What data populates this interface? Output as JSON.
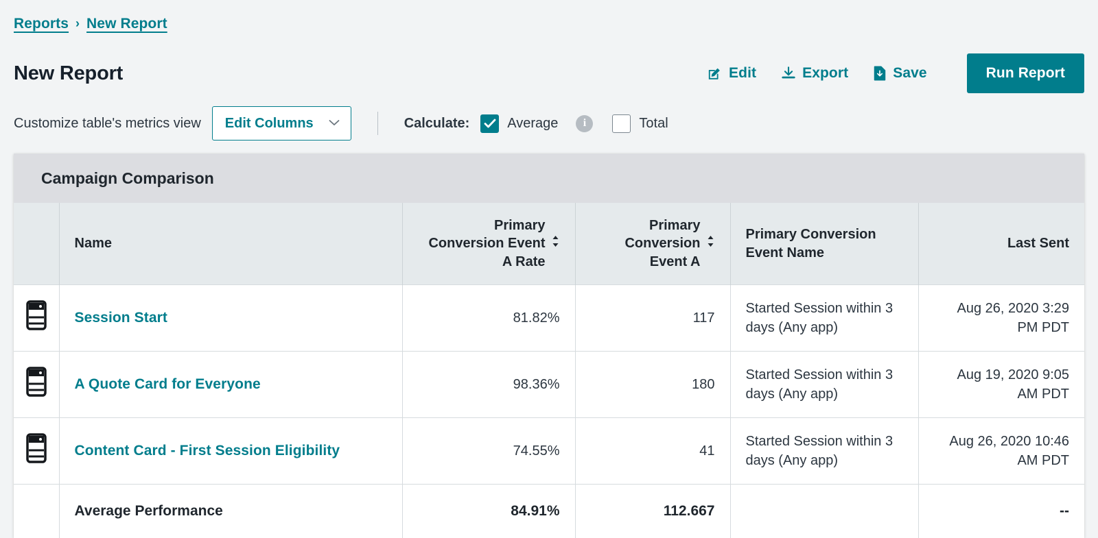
{
  "theme": {
    "accent": "#017d8c",
    "page_bg": "#f2f4f5",
    "card_header_bg": "#dcdde1",
    "table_header_bg": "#e5eaec"
  },
  "breadcrumb": {
    "items": [
      {
        "label": "Reports"
      },
      {
        "label": "New Report"
      }
    ],
    "separator": "›"
  },
  "header": {
    "title": "New Report",
    "actions": [
      {
        "label": "Edit",
        "icon": "edit-pencil-icon"
      },
      {
        "label": "Export",
        "icon": "download-icon"
      },
      {
        "label": "Save",
        "icon": "save-file-icon"
      }
    ],
    "primary_action": {
      "label": "Run Report"
    }
  },
  "toolbar": {
    "customize_label": "Customize table's metrics view",
    "edit_columns_label": "Edit Columns",
    "chevron_icon": "chevron-down-icon",
    "calculate_label": "Calculate:",
    "average_label": "Average",
    "average_checked": true,
    "info_icon_label": "i",
    "total_label": "Total",
    "total_checked": false
  },
  "table": {
    "card_title": "Campaign Comparison",
    "columns": [
      {
        "key": "icon",
        "label": ""
      },
      {
        "key": "name",
        "label": "Name",
        "sortable": false
      },
      {
        "key": "rate",
        "label": "Primary Conversion Event A Rate",
        "sortable": true
      },
      {
        "key": "count",
        "label": "Primary Conversion Event A",
        "sortable": true
      },
      {
        "key": "event_name",
        "label": "Primary Conversion Event Name",
        "sortable": false
      },
      {
        "key": "last_sent",
        "label": "Last Sent",
        "sortable": false
      }
    ],
    "rows": [
      {
        "icon": "content-card-icon",
        "name": "Session Start",
        "rate": "81.82%",
        "count": "117",
        "event_name": "Started Session within 3 days (Any app)",
        "last_sent": "Aug 26, 2020 3:29 PM PDT"
      },
      {
        "icon": "content-card-icon",
        "name": "A Quote Card for Everyone",
        "rate": "98.36%",
        "count": "180",
        "event_name": "Started Session within 3 days (Any app)",
        "last_sent": "Aug 19, 2020 9:05 AM PDT"
      },
      {
        "icon": "content-card-icon",
        "name": "Content Card - First Session Eligibility",
        "rate": "74.55%",
        "count": "41",
        "event_name": "Started Session within 3 days (Any app)",
        "last_sent": "Aug 26, 2020 10:46 AM PDT"
      }
    ],
    "summary": {
      "label": "Average Performance",
      "rate": "84.91%",
      "count": "112.667",
      "event_name": "",
      "last_sent": "--"
    }
  }
}
